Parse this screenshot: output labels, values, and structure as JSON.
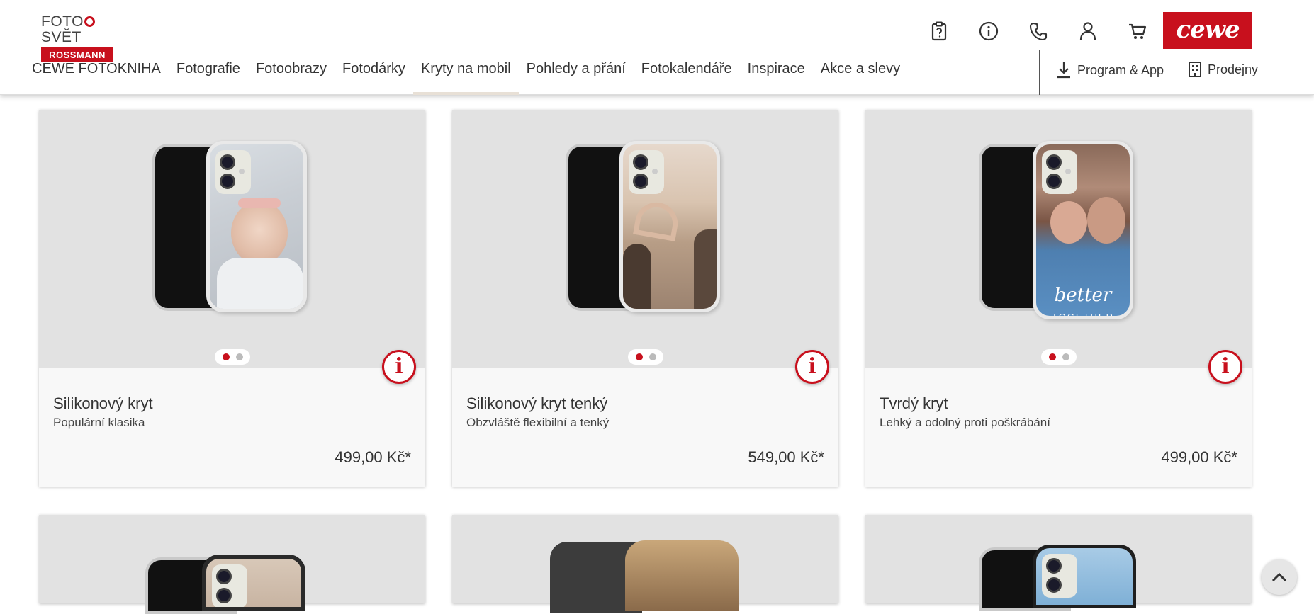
{
  "logo": {
    "top_text": "FOTO SVĚT",
    "bottom_text": "ROSSMANN"
  },
  "brand_badge": "cewe",
  "top_icons": [
    "clipboard-icon",
    "info-icon",
    "phone-icon",
    "user-icon",
    "cart-icon"
  ],
  "nav": {
    "items": [
      {
        "label": "CEWE FOTOKNIHA"
      },
      {
        "label": "Fotografie"
      },
      {
        "label": "Fotoobrazy"
      },
      {
        "label": "Fotodárky"
      },
      {
        "label": "Kryty na mobil",
        "active": true
      },
      {
        "label": "Pohledy a přání"
      },
      {
        "label": "Fotokalendáře"
      },
      {
        "label": "Inspirace"
      },
      {
        "label": "Akce a slevy"
      }
    ],
    "program_app": "Program & App",
    "prodejny": "Prodejny"
  },
  "products": [
    {
      "title": "Silikonový kryt",
      "subtitle": "Populární klasika",
      "price": "499,00 Kč*"
    },
    {
      "title": "Silikonový kryt tenký",
      "subtitle": "Obzvláště flexibilní a tenký",
      "price": "549,00 Kč*"
    },
    {
      "title": "Tvrdý kryt",
      "subtitle": "Lehký a odolný proti poškrábání",
      "price": "499,00 Kč*"
    }
  ],
  "case_print_text": {
    "line1": "better",
    "line2": "TOGETHER"
  },
  "info_label": "i",
  "colors": {
    "brand_red": "#c8101d",
    "card_image_bg": "#e2e2e2",
    "card_body_bg": "#f8f8f8"
  }
}
